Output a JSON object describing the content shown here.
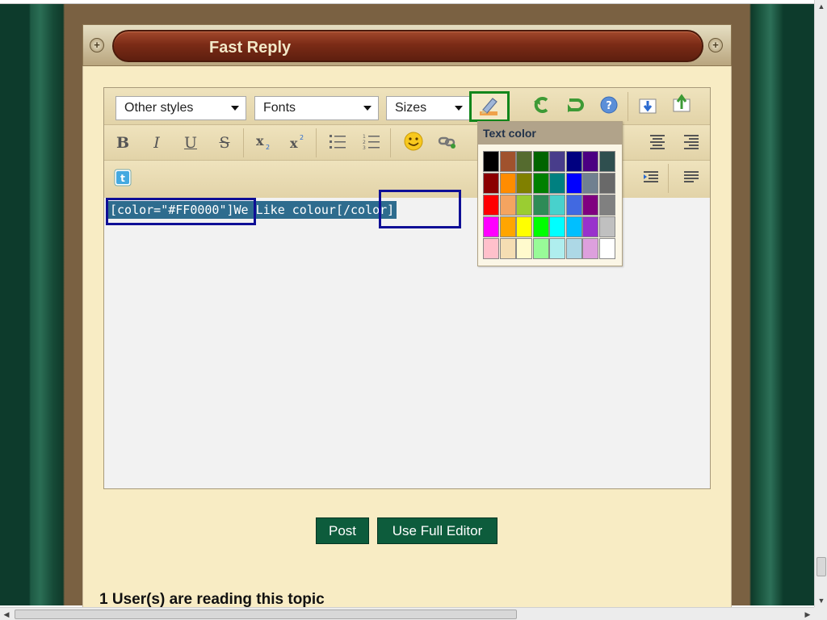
{
  "title": "Fast Reply",
  "toolbar": {
    "styles_select": "Other styles",
    "fonts_select": "Fonts",
    "sizes_select": "Sizes",
    "bold_label": "B",
    "italic_label": "I",
    "underline_label": "U",
    "strike_label": "S"
  },
  "editor": {
    "segment_open": "[color=\"#FF0000\"]",
    "segment_text": "We Like colour",
    "segment_close": "[/color]"
  },
  "color_popup": {
    "title": "Text color",
    "colors": [
      "#000000",
      "#a0522d",
      "#556b2f",
      "#006400",
      "#483d8b",
      "#000080",
      "#4b0082",
      "#2f4f4f",
      "#8b0000",
      "#ff8c00",
      "#808000",
      "#008000",
      "#008080",
      "#0000ff",
      "#708090",
      "#696969",
      "#ff0000",
      "#f4a460",
      "#9acd32",
      "#2e8b57",
      "#48d1cc",
      "#4169e1",
      "#800080",
      "#808080",
      "#ff00ff",
      "#ffa500",
      "#ffff00",
      "#00ff00",
      "#00ffff",
      "#00bfff",
      "#9932cc",
      "#c0c0c0",
      "#ffc0cb",
      "#f5deb3",
      "#fffacd",
      "#98fb98",
      "#afeeee",
      "#add8e6",
      "#dda0dd",
      "#ffffff"
    ]
  },
  "buttons": {
    "post": "Post",
    "full_editor": "Use Full Editor"
  },
  "readers_text": "1 User(s) are reading this topic",
  "icons": [
    "add-icon",
    "text-color-icon",
    "undo-icon",
    "redo-icon",
    "help-icon",
    "import-icon",
    "export-icon",
    "subscript-icon",
    "superscript-icon",
    "bullet-list-icon",
    "numbered-list-icon",
    "emoticon-icon",
    "link-icon",
    "align-center-icon",
    "align-right-icon",
    "twitter-icon",
    "indent-icon",
    "justify-icon"
  ]
}
